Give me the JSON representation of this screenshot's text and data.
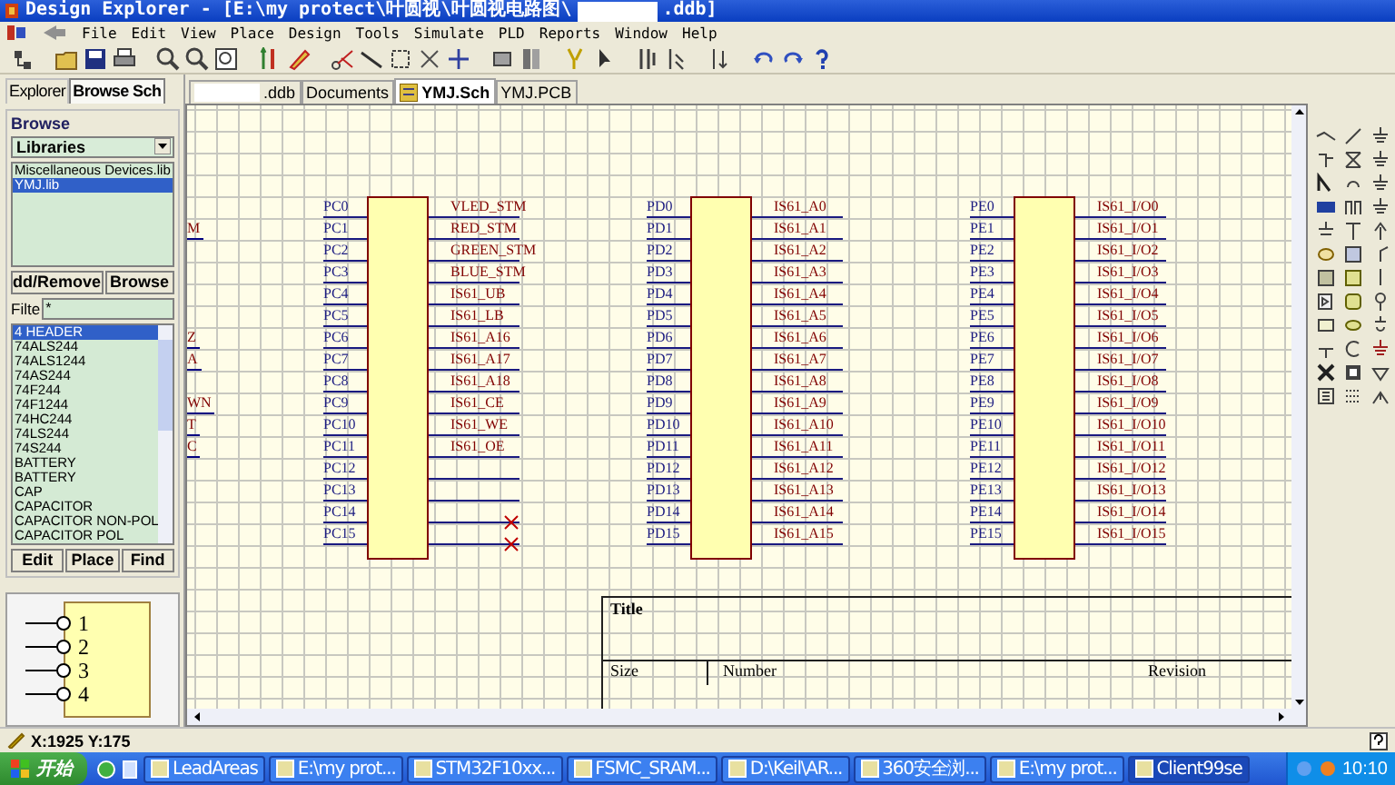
{
  "window": {
    "title": "Design Explorer - [E:\\my protect\\叶圆视\\叶圆视电路图\\",
    "redacted": true,
    "title_end": ".ddb]"
  },
  "menu": [
    "File",
    "Edit",
    "View",
    "Place",
    "Design",
    "Tools",
    "Simulate",
    "PLD",
    "Reports",
    "Window",
    "Help"
  ],
  "panel_tabs": [
    {
      "label": "Explorer",
      "selected": false
    },
    {
      "label": "Browse Sch",
      "selected": true
    }
  ],
  "browse": {
    "heading": "Browse",
    "dropdown": "Libraries",
    "libraries": [
      {
        "label": "Miscellaneous Devices.lib",
        "selected": false
      },
      {
        "label": "YMJ.lib",
        "selected": true
      }
    ],
    "library_buttons": [
      "dd/Remove",
      "Browse"
    ],
    "filter_label": "Filte",
    "filter_value": "*",
    "parts": [
      {
        "label": "4 HEADER",
        "selected": true
      },
      {
        "label": "74ALS244",
        "selected": false
      },
      {
        "label": "74ALS1244",
        "selected": false
      },
      {
        "label": "74AS244",
        "selected": false
      },
      {
        "label": "74F244",
        "selected": false
      },
      {
        "label": "74F1244",
        "selected": false
      },
      {
        "label": "74HC244",
        "selected": false
      },
      {
        "label": "74LS244",
        "selected": false
      },
      {
        "label": "74S244",
        "selected": false
      },
      {
        "label": "BATTERY",
        "selected": false
      },
      {
        "label": "BATTERY",
        "selected": false
      },
      {
        "label": "CAP",
        "selected": false
      },
      {
        "label": "CAPACITOR",
        "selected": false
      },
      {
        "label": "CAPACITOR NON-POL",
        "selected": false
      },
      {
        "label": "CAPACITOR POL",
        "selected": false
      }
    ],
    "part_buttons": [
      "Edit",
      "Place",
      "Find"
    ],
    "preview_pins": [
      "1",
      "2",
      "3",
      "4"
    ]
  },
  "doc_tabs": [
    {
      "label": ".ddb",
      "redacted": true,
      "selected": false
    },
    {
      "label": "Documents",
      "redacted": false,
      "selected": false
    },
    {
      "label": "YMJ.Sch",
      "redacted": false,
      "selected": true
    },
    {
      "label": "YMJ.PCB",
      "redacted": false,
      "selected": false
    }
  ],
  "schematic": {
    "edge_labels": [
      "M",
      "Z",
      "A",
      "WN",
      "T",
      "C"
    ],
    "components": [
      {
        "pins": [
          {
            "pin": "PC0",
            "net": "VLED_STM"
          },
          {
            "pin": "PC1",
            "net": "RED_STM"
          },
          {
            "pin": "PC2",
            "net": "GREEN_STM"
          },
          {
            "pin": "PC3",
            "net": "BLUE_STM"
          },
          {
            "pin": "PC4",
            "net": "IS61_UB"
          },
          {
            "pin": "PC5",
            "net": "IS61_LB"
          },
          {
            "pin": "PC6",
            "net": "IS61_A16"
          },
          {
            "pin": "PC7",
            "net": "IS61_A17"
          },
          {
            "pin": "PC8",
            "net": "IS61_A18"
          },
          {
            "pin": "PC9",
            "net": "IS61_CE"
          },
          {
            "pin": "PC10",
            "net": "IS61_WE"
          },
          {
            "pin": "PC11",
            "net": "IS61_OE"
          },
          {
            "pin": "PC12"
          },
          {
            "pin": "PC13"
          },
          {
            "pin": "PC14",
            "no_connect": true
          },
          {
            "pin": "PC15",
            "no_connect": true
          }
        ]
      },
      {
        "pins": [
          {
            "pin": "PD0",
            "net": "IS61_A0"
          },
          {
            "pin": "PD1",
            "net": "IS61_A1"
          },
          {
            "pin": "PD2",
            "net": "IS61_A2"
          },
          {
            "pin": "PD3",
            "net": "IS61_A3"
          },
          {
            "pin": "PD4",
            "net": "IS61_A4"
          },
          {
            "pin": "PD5",
            "net": "IS61_A5"
          },
          {
            "pin": "PD6",
            "net": "IS61_A6"
          },
          {
            "pin": "PD7",
            "net": "IS61_A7"
          },
          {
            "pin": "PD8",
            "net": "IS61_A8"
          },
          {
            "pin": "PD9",
            "net": "IS61_A9"
          },
          {
            "pin": "PD10",
            "net": "IS61_A10"
          },
          {
            "pin": "PD11",
            "net": "IS61_A11"
          },
          {
            "pin": "PD12",
            "net": "IS61_A12"
          },
          {
            "pin": "PD13",
            "net": "IS61_A13"
          },
          {
            "pin": "PD14",
            "net": "IS61_A14"
          },
          {
            "pin": "PD15",
            "net": "IS61_A15"
          }
        ]
      },
      {
        "pins": [
          {
            "pin": "PE0",
            "net": "IS61_I/O0"
          },
          {
            "pin": "PE1",
            "net": "IS61_I/O1"
          },
          {
            "pin": "PE2",
            "net": "IS61_I/O2"
          },
          {
            "pin": "PE3",
            "net": "IS61_I/O3"
          },
          {
            "pin": "PE4",
            "net": "IS61_I/O4"
          },
          {
            "pin": "PE5",
            "net": "IS61_I/O5"
          },
          {
            "pin": "PE6",
            "net": "IS61_I/O6"
          },
          {
            "pin": "PE7",
            "net": "IS61_I/O7"
          },
          {
            "pin": "PE8",
            "net": "IS61_I/O8"
          },
          {
            "pin": "PE9",
            "net": "IS61_I/O9"
          },
          {
            "pin": "PE10",
            "net": "IS61_I/O10"
          },
          {
            "pin": "PE11",
            "net": "IS61_I/O11"
          },
          {
            "pin": "PE12",
            "net": "IS61_I/O12"
          },
          {
            "pin": "PE13",
            "net": "IS61_I/O13"
          },
          {
            "pin": "PE14",
            "net": "IS61_I/O14"
          },
          {
            "pin": "PE15",
            "net": "IS61_I/O15"
          }
        ]
      }
    ],
    "title_block": {
      "title": "Title",
      "size": "Size",
      "number": "Number",
      "revision": "Revision"
    }
  },
  "status_bar": {
    "coords": "X:1925 Y:175"
  },
  "taskbar": {
    "start": "开始",
    "items": [
      {
        "label": "LeadAreas",
        "selected": false
      },
      {
        "label": "E:\\my prot...",
        "selected": false
      },
      {
        "label": "STM32F10xx...",
        "selected": false
      },
      {
        "label": "FSMC_SRAM...",
        "selected": false
      },
      {
        "label": "D:\\Keil\\AR...",
        "selected": false
      },
      {
        "label": "360安全浏...",
        "selected": false
      },
      {
        "label": "E:\\my prot...",
        "selected": false
      },
      {
        "label": "Client99se",
        "selected": true
      }
    ],
    "clock": "10:10"
  }
}
